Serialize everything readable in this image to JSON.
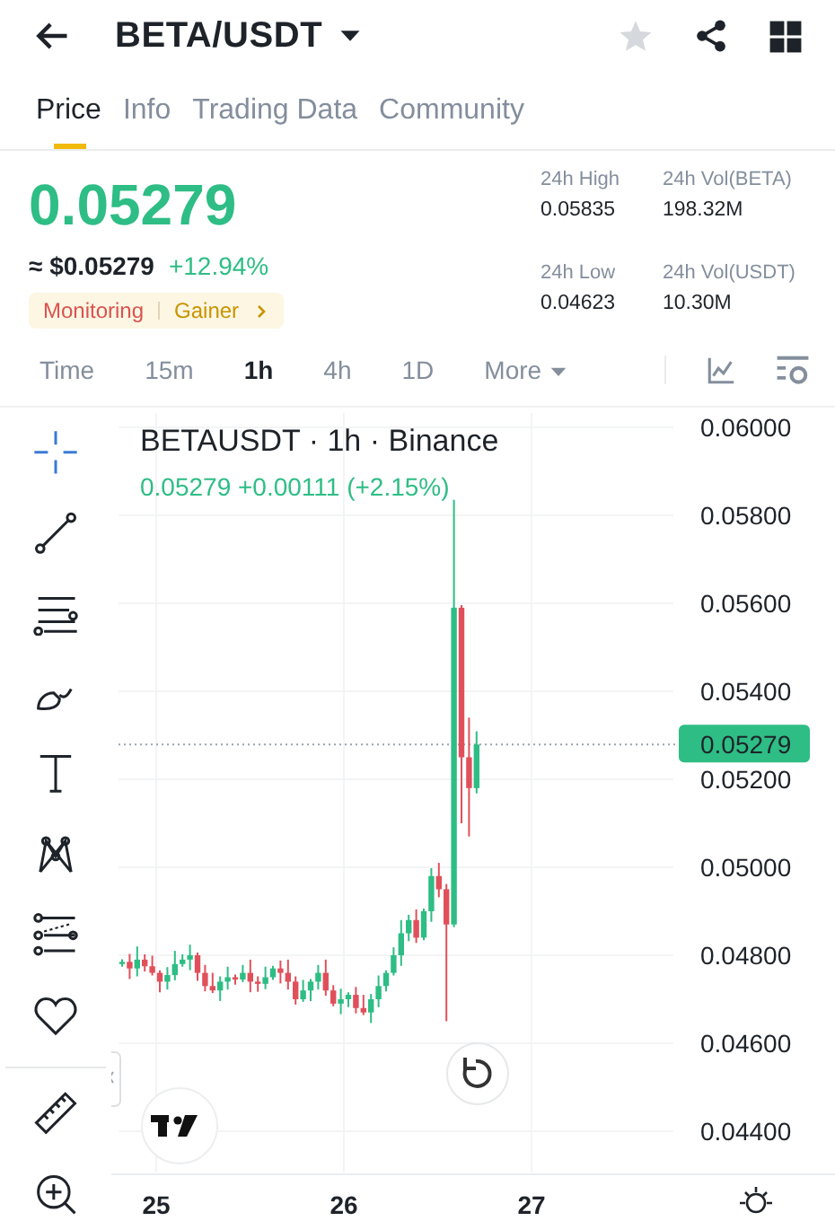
{
  "header": {
    "title": "BETA/USDT",
    "favorite": false
  },
  "tabs": [
    {
      "label": "Price",
      "selected": true
    },
    {
      "label": "Info",
      "selected": false
    },
    {
      "label": "Trading Data",
      "selected": false
    },
    {
      "label": "Community",
      "selected": false
    }
  ],
  "price": {
    "last": "0.05279",
    "usd": "≈ $0.05279",
    "change": "+12.94%",
    "tags": [
      {
        "label": "Monitoring",
        "color": "#d9534f"
      },
      {
        "label": "Gainer",
        "color": "#c99400"
      }
    ]
  },
  "stats": [
    {
      "label": "24h High",
      "value": "0.05835"
    },
    {
      "label": "24h Vol(BETA)",
      "value": "198.32M"
    },
    {
      "label": "24h Low",
      "value": "0.04623"
    },
    {
      "label": "24h Vol(USDT)",
      "value": "10.30M"
    }
  ],
  "intervals": [
    {
      "label": "Time",
      "selected": false,
      "kind": "plain"
    },
    {
      "label": "15m",
      "selected": false,
      "kind": "plain"
    },
    {
      "label": "1h",
      "selected": true,
      "kind": "plain"
    },
    {
      "label": "4h",
      "selected": false,
      "kind": "plain"
    },
    {
      "label": "1D",
      "selected": false,
      "kind": "plain"
    },
    {
      "label": "More",
      "selected": false,
      "kind": "menu"
    }
  ],
  "chart": {
    "title": "BETAUSDT · 1h · Binance",
    "ohlc": "0.05279  +0.00111 (+2.15%)",
    "price_labels": [
      "0.06000",
      "0.05800",
      "0.05600",
      "0.05400",
      "0.05200",
      "0.05000",
      "0.04800",
      "0.04600",
      "0.04400"
    ],
    "current_price": "0.05279",
    "date_labels": [
      "25",
      "26",
      "27"
    ]
  }
}
